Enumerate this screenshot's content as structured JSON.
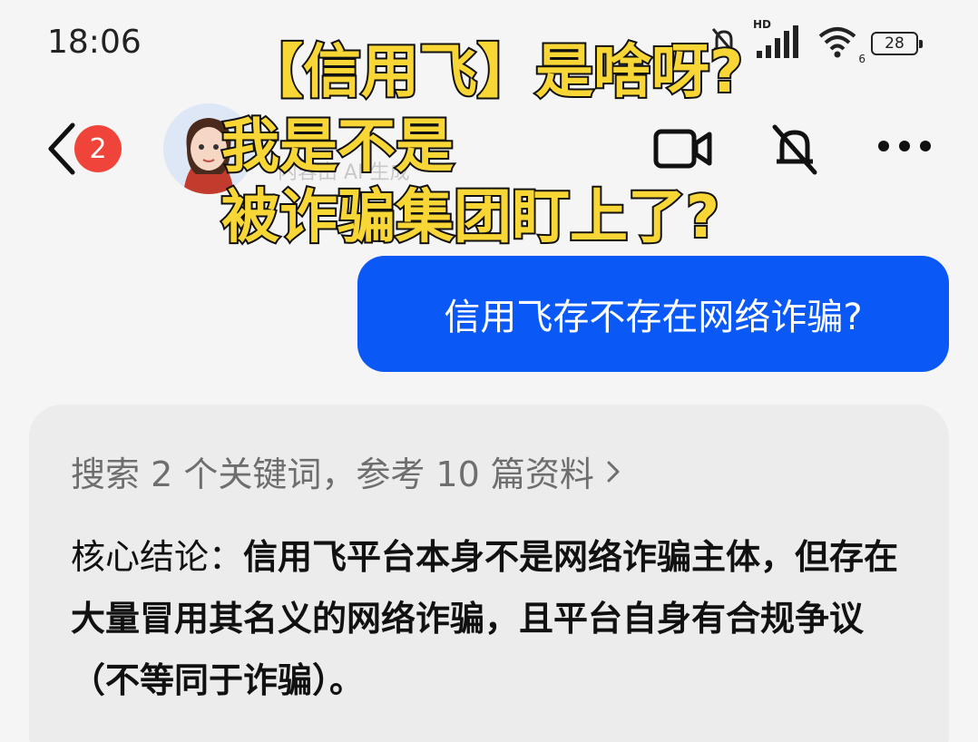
{
  "status_bar": {
    "time": "18:06",
    "battery": "28",
    "hd_label": "HD",
    "wifi_sub": "6",
    "icons": [
      "mute-bell-icon",
      "signal-icon",
      "wifi-icon",
      "battery-icon"
    ]
  },
  "header": {
    "unread_count": "2",
    "ai_label": "内容由 AI 生成",
    "icons": [
      "back-chevron-icon",
      "video-camera-icon",
      "mute-icon",
      "more-dots-icon"
    ]
  },
  "overlay_caption": {
    "line1": "【信用飞】是啥呀?",
    "line2": "我是不是",
    "line3": "被诈骗集团盯上了?"
  },
  "chat": {
    "user_message": "信用飞存不存在网络诈骗?",
    "reply": {
      "search_summary": "搜索 2 个关键词，参考 10 篇资料",
      "conclusion_label": "核心结论：",
      "conclusion_text": "信用飞平台本身不是网络诈骗主体，但存在大量冒用其名义的网络诈骗，且平台自身有合规争议（不等同于诈骗）。"
    }
  },
  "colors": {
    "bubble_blue": "#0a59f7",
    "badge_red": "#f0443a",
    "caption_yellow": "#f7d635"
  }
}
